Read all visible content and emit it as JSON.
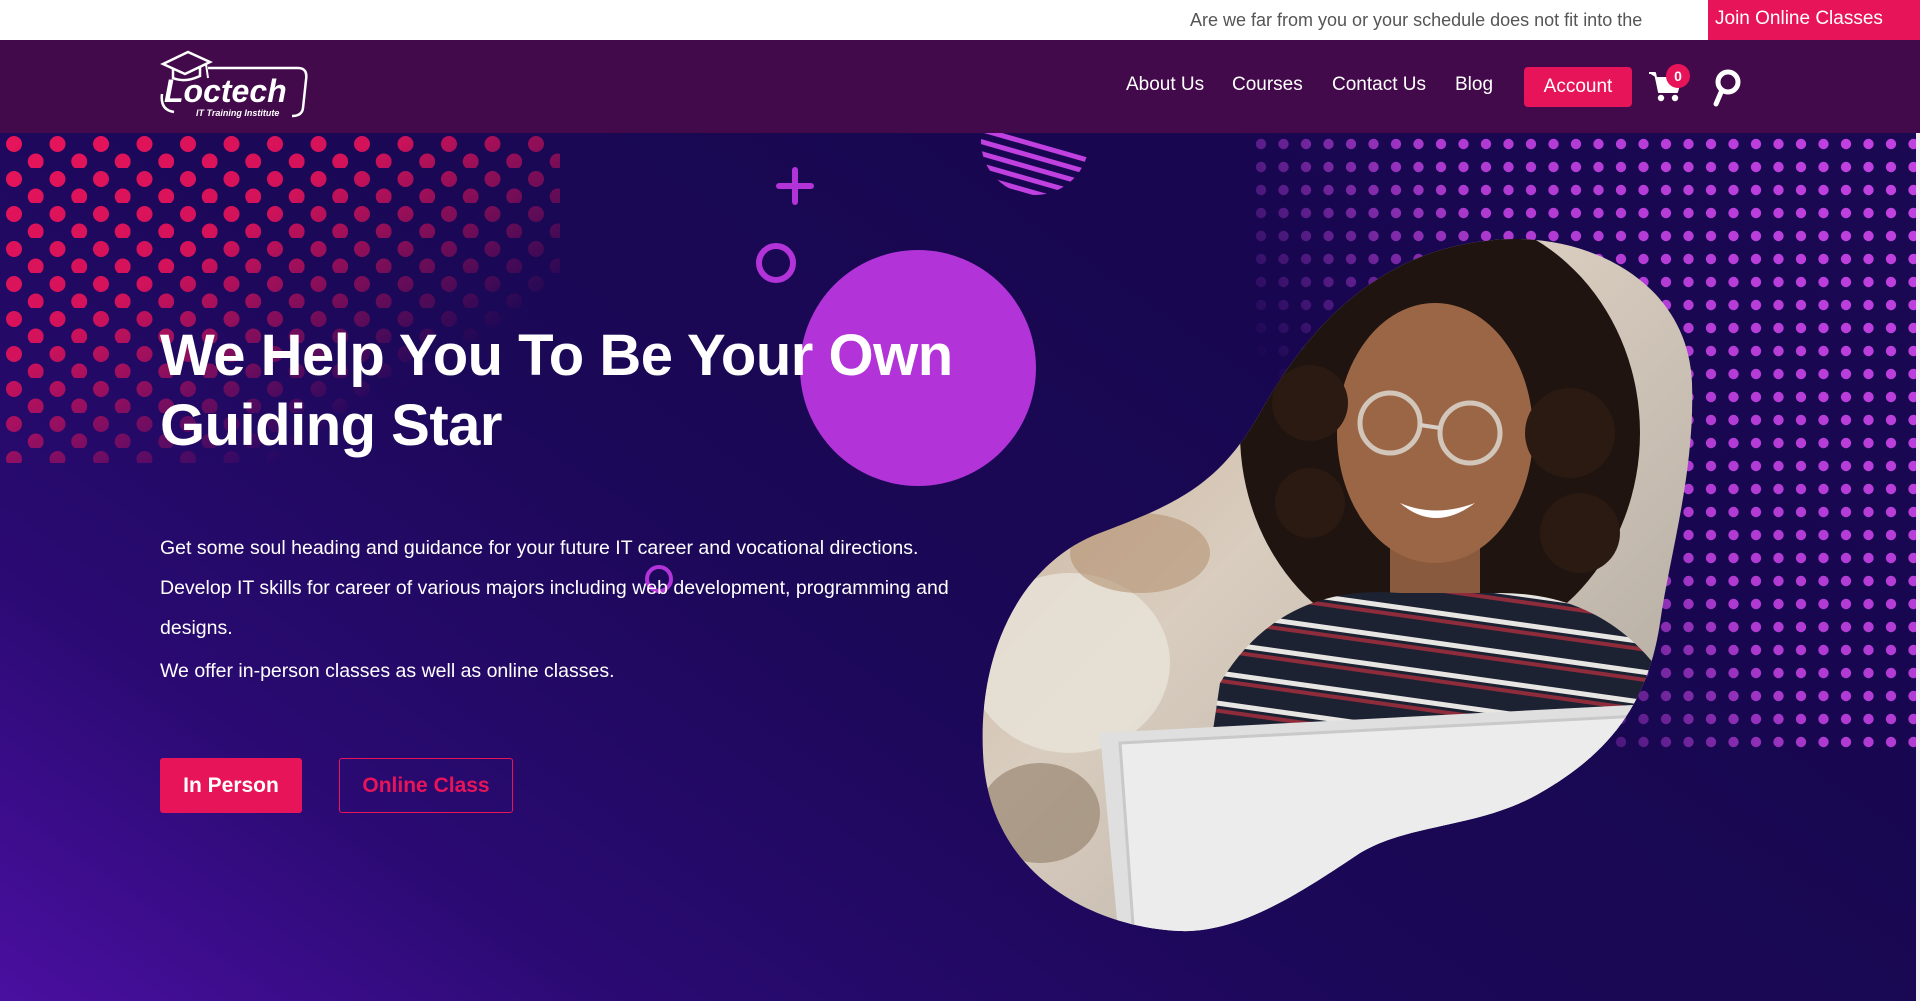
{
  "announcement": {
    "text": "Are we far from you or your schedule does not fit into the",
    "cta": "Join Online Classes"
  },
  "brand": {
    "name": "Loctech",
    "tagline": "IT Training Institute"
  },
  "nav": {
    "items": [
      {
        "label": "About Us"
      },
      {
        "label": "Courses"
      },
      {
        "label": "Contact Us"
      },
      {
        "label": "Blog"
      }
    ],
    "account": "Account",
    "cart_count": "0"
  },
  "hero": {
    "headline_line1": "We Help You To Be Your Own",
    "headline_line2": "Guiding Star",
    "description": "Get some soul heading and guidance for your future IT career and vocational directions. Develop IT skills for career of various majors including web development, programming and designs.",
    "description2": "We offer in-person classes as well as online classes.",
    "btn_in_person": "In Person",
    "btn_online": "Online Class"
  },
  "colors": {
    "accent": "#e8145a",
    "header_bg": "#420a4a",
    "hero_bg": "#180750",
    "purple_shape": "#b233d8"
  },
  "icons": [
    "graduation-cap-icon",
    "cart-icon",
    "search-icon"
  ]
}
